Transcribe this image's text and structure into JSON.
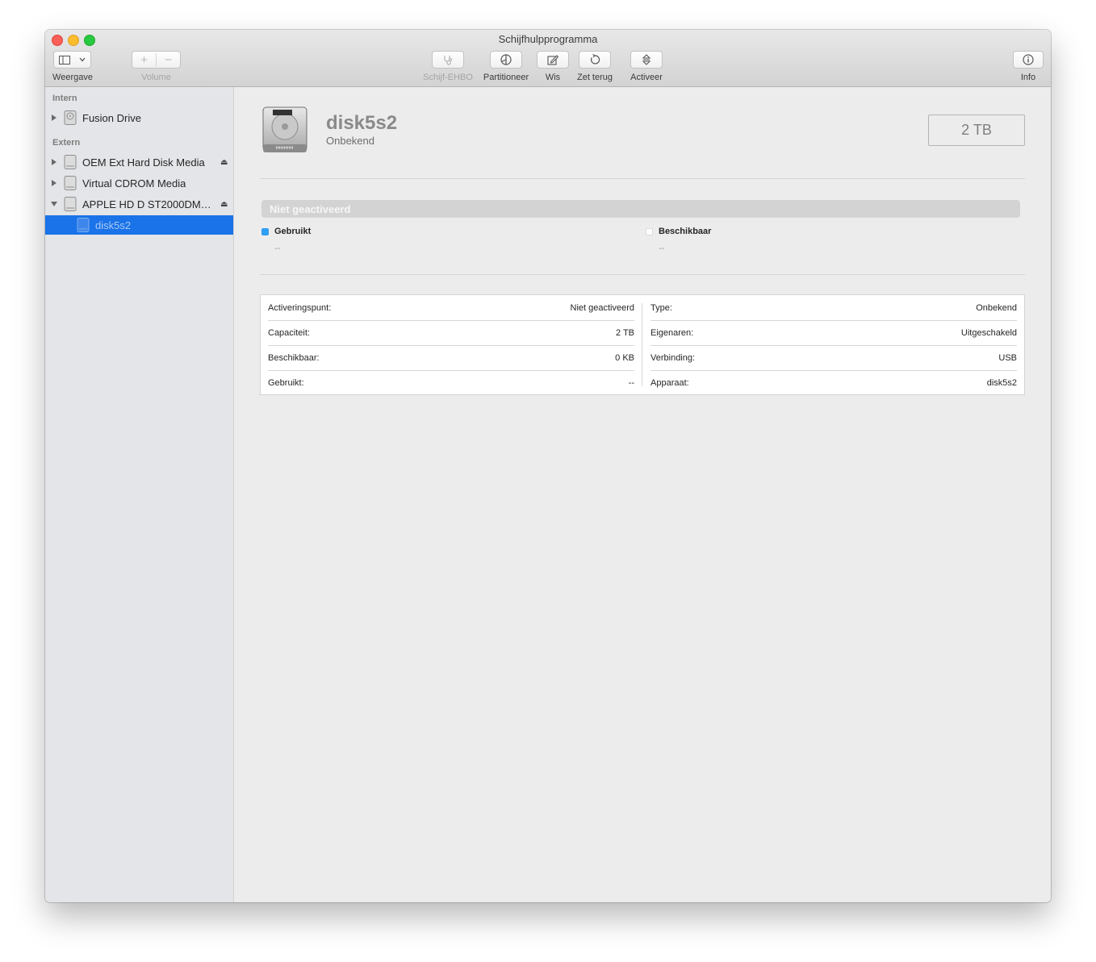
{
  "window": {
    "title": "Schijfhulpprogramma"
  },
  "toolbar": {
    "view_label": "Weergave",
    "volume_label": "Volume",
    "firstaid_label": "Schijf-EHBO",
    "partition_label": "Partitioneer",
    "erase_label": "Wis",
    "restore_label": "Zet terug",
    "mount_label": "Activeer",
    "info_label": "Info",
    "add_glyph": "+",
    "remove_glyph": "−"
  },
  "sidebar": {
    "sections": [
      {
        "title": "Intern"
      },
      {
        "title": "Extern"
      }
    ],
    "items": [
      {
        "label": "Fusion Drive",
        "expanded": false,
        "ejectable": false
      },
      {
        "label": "OEM Ext Hard Disk Media",
        "expanded": false,
        "ejectable": true
      },
      {
        "label": "Virtual CDROM Media",
        "expanded": false,
        "ejectable": false
      },
      {
        "label": "APPLE HD D ST2000DM…",
        "expanded": true,
        "ejectable": true
      },
      {
        "label": "disk5s2",
        "selected": true
      }
    ],
    "eject_glyph": "⏏"
  },
  "volume": {
    "name": "disk5s2",
    "subtitle": "Onbekend",
    "size": "2 TB"
  },
  "usage": {
    "bar_label": "Niet geactiveerd",
    "used_label": "Gebruikt",
    "used_value": "--",
    "free_label": "Beschikbaar",
    "free_value": "--",
    "used_color": "#2f9ef4",
    "free_color": "#ffffff"
  },
  "info": {
    "left": [
      {
        "key": "Activeringspunt:",
        "value": "Niet geactiveerd"
      },
      {
        "key": "Capaciteit:",
        "value": "2 TB"
      },
      {
        "key": "Beschikbaar:",
        "value": "0 KB"
      },
      {
        "key": "Gebruikt:",
        "value": "--"
      }
    ],
    "right": [
      {
        "key": "Type:",
        "value": "Onbekend"
      },
      {
        "key": "Eigenaren:",
        "value": "Uitgeschakeld"
      },
      {
        "key": "Verbinding:",
        "value": "USB"
      },
      {
        "key": "Apparaat:",
        "value": "disk5s2"
      }
    ]
  },
  "colors": {
    "selection": "#1a73e8",
    "sidebar_bg": "#e3e5e8"
  }
}
